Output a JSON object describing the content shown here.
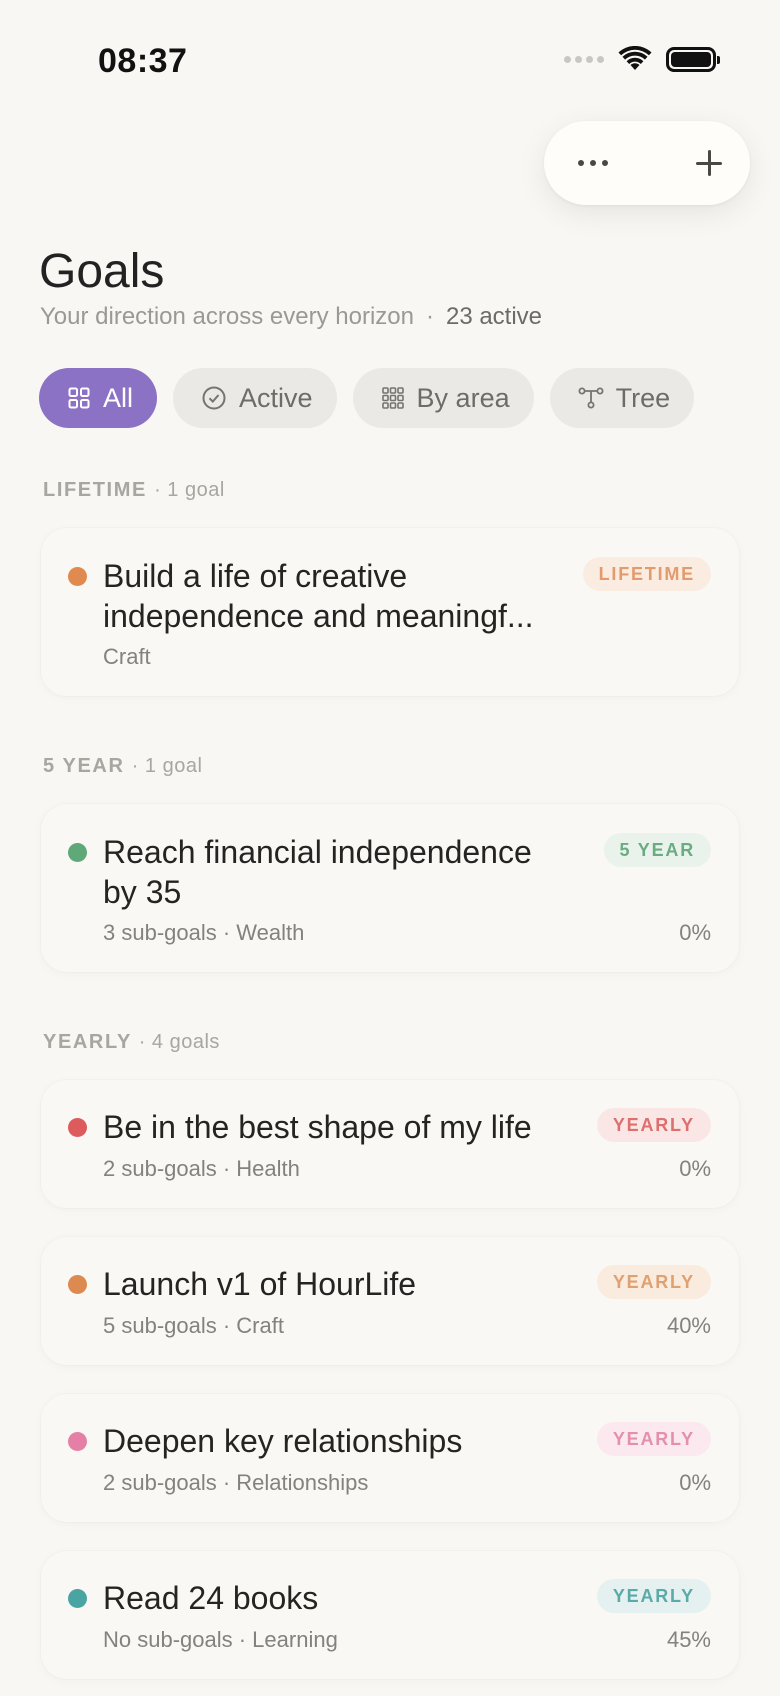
{
  "status_bar": {
    "time": "08:37"
  },
  "header": {
    "title": "Goals",
    "subtitle": "Your direction across every horizon",
    "separator": "·",
    "active_count": "23 active"
  },
  "filters": [
    {
      "label": "All",
      "icon": "grid-icon",
      "selected": true
    },
    {
      "label": "Active",
      "icon": "check-circle-icon",
      "selected": false
    },
    {
      "label": "By area",
      "icon": "dots-grid-icon",
      "selected": false
    },
    {
      "label": "Tree",
      "icon": "tree-icon",
      "selected": false
    }
  ],
  "sections": {
    "lifetime": {
      "name": "LIFETIME",
      "count": "· 1 goal"
    },
    "five_year": {
      "name": "5 YEAR",
      "count": "· 1 goal"
    },
    "yearly": {
      "name": "YEARLY",
      "count": "· 4 goals"
    }
  },
  "goals": [
    {
      "title": "Build a life of creative independence and meaningf...",
      "meta": "Craft",
      "badge": "LIFETIME",
      "percent": "",
      "dot_color": "#e08a50",
      "badge_color": "#e39a6c",
      "badge_bg": "#fbece1"
    },
    {
      "title": "Reach financial independence by 35",
      "meta": "3 sub-goals · Wealth",
      "badge": "5 YEAR",
      "percent": "0%",
      "dot_color": "#5fa877",
      "badge_color": "#6aac82",
      "badge_bg": "#e9f3ec"
    },
    {
      "title": "Be in the best shape of my life",
      "meta": "2 sub-goals · Health",
      "badge": "YEARLY",
      "percent": "0%",
      "dot_color": "#dd5b5d",
      "badge_color": "#dd6f6f",
      "badge_bg": "#fae7e5"
    },
    {
      "title": "Launch v1 of HourLife",
      "meta": "5 sub-goals · Craft",
      "badge": "YEARLY",
      "percent": "40%",
      "dot_color": "#dc8a50",
      "badge_color": "#e0a070",
      "badge_bg": "#f9ebde"
    },
    {
      "title": "Deepen key relationships",
      "meta": "2 sub-goals · Relationships",
      "badge": "YEARLY",
      "percent": "0%",
      "dot_color": "#e57fa6",
      "badge_color": "#e58fae",
      "badge_bg": "#fbe9ef"
    },
    {
      "title": "Read 24 books",
      "meta": "No sub-goals · Learning",
      "badge": "YEARLY",
      "percent": "45%",
      "dot_color": "#4aa5a2",
      "badge_color": "#5aaba7",
      "badge_bg": "#e5f1f0"
    }
  ]
}
